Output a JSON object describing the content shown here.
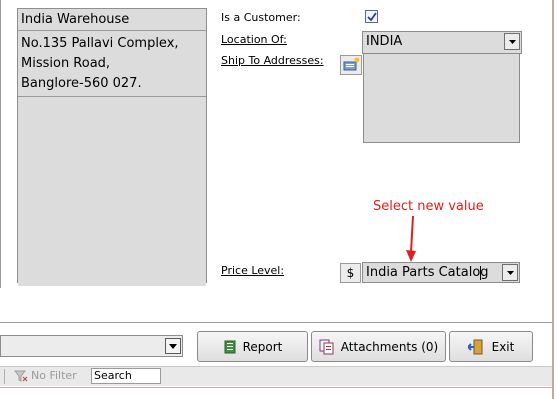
{
  "address": {
    "name": "India Warehouse",
    "text": "No.135 Pallavi Complex,\nMission Road,\nBanglore-560 027."
  },
  "fields": {
    "is_customer_label": "Is a Customer:",
    "is_customer_checked": true,
    "location_label": "Location Of:",
    "location_value": "INDIA",
    "ship_label": "Ship To Addresses:",
    "price_level_label": "Price Level:",
    "currency_symbol": "$",
    "price_level_value": "India Parts Catalog"
  },
  "callout": {
    "text": "Select new value",
    "color": "#e0201a"
  },
  "toolbar": {
    "report_label": "Report",
    "attachments_label": "Attachments (0)",
    "exit_label": "Exit"
  },
  "navbar": {
    "no_filter_label": "No Filter",
    "search_placeholder": "Search"
  },
  "icons": {
    "ship": "address-book-icon",
    "report": "report-icon",
    "attachments": "attachments-icon",
    "exit": "exit-door-icon",
    "filter": "no-filter-icon"
  }
}
